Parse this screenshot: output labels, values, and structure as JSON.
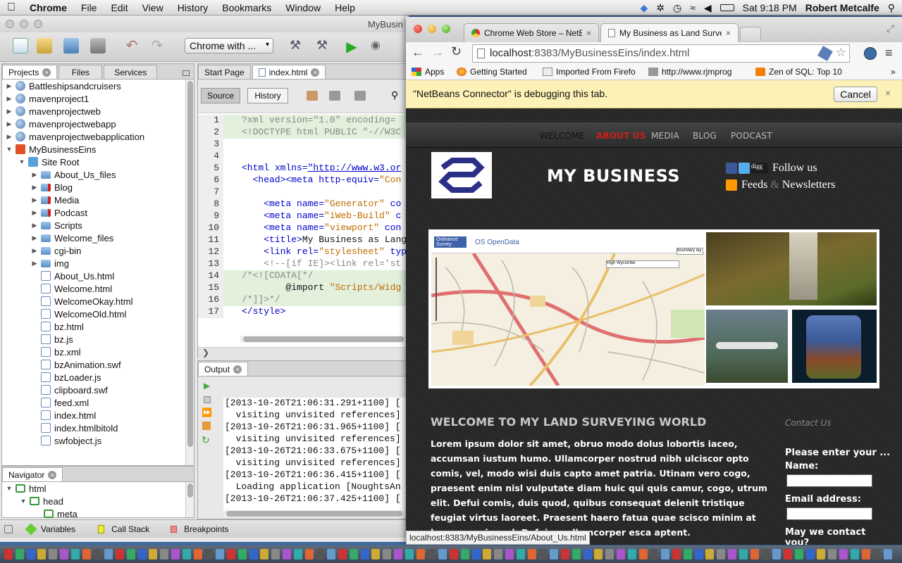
{
  "menubar": {
    "app": "Chrome",
    "items": [
      "File",
      "Edit",
      "View",
      "History",
      "Bookmarks",
      "Window",
      "Help"
    ],
    "clock": "Sat 9:18 PM",
    "user": "Robert Metcalfe"
  },
  "netbeans": {
    "title": "MyBusin",
    "run_config": "Chrome with ...",
    "panel_tabs": [
      "Projects",
      "Files",
      "Services"
    ],
    "projects": [
      {
        "label": "Battleshipsandcruisers",
        "indent": 0,
        "arrow": "closed",
        "icon": "globe"
      },
      {
        "label": "mavenproject1",
        "indent": 0,
        "arrow": "closed",
        "icon": "globe"
      },
      {
        "label": "mavenprojectweb",
        "indent": 0,
        "arrow": "closed",
        "icon": "globe"
      },
      {
        "label": "mavenprojectwebapp",
        "indent": 0,
        "arrow": "closed",
        "icon": "globe"
      },
      {
        "label": "mavenprojectwebapplication",
        "indent": 0,
        "arrow": "closed",
        "icon": "globe"
      },
      {
        "label": "MyBusinessEins",
        "indent": 0,
        "arrow": "open",
        "icon": "h5"
      },
      {
        "label": "Site Root",
        "indent": 1,
        "arrow": "open",
        "icon": "site"
      },
      {
        "label": "About_Us_files",
        "indent": 2,
        "arrow": "closed",
        "icon": "folder"
      },
      {
        "label": "Blog",
        "indent": 2,
        "arrow": "closed",
        "icon": "lfolder"
      },
      {
        "label": "Media",
        "indent": 2,
        "arrow": "closed",
        "icon": "lfolder"
      },
      {
        "label": "Podcast",
        "indent": 2,
        "arrow": "closed",
        "icon": "lfolder"
      },
      {
        "label": "Scripts",
        "indent": 2,
        "arrow": "closed",
        "icon": "folder"
      },
      {
        "label": "Welcome_files",
        "indent": 2,
        "arrow": "closed",
        "icon": "folder"
      },
      {
        "label": "cgi-bin",
        "indent": 2,
        "arrow": "closed",
        "icon": "folder"
      },
      {
        "label": "img",
        "indent": 2,
        "arrow": "closed",
        "icon": "folder"
      },
      {
        "label": "About_Us.html",
        "indent": 2,
        "arrow": "none",
        "icon": "file"
      },
      {
        "label": "Welcome.html",
        "indent": 2,
        "arrow": "none",
        "icon": "file"
      },
      {
        "label": "WelcomeOkay.html",
        "indent": 2,
        "arrow": "none",
        "icon": "file"
      },
      {
        "label": "WelcomeOld.html",
        "indent": 2,
        "arrow": "none",
        "icon": "file"
      },
      {
        "label": "bz.html",
        "indent": 2,
        "arrow": "none",
        "icon": "file"
      },
      {
        "label": "bz.js",
        "indent": 2,
        "arrow": "none",
        "icon": "file"
      },
      {
        "label": "bz.xml",
        "indent": 2,
        "arrow": "none",
        "icon": "file"
      },
      {
        "label": "bzAnimation.swf",
        "indent": 2,
        "arrow": "none",
        "icon": "file"
      },
      {
        "label": "bzLoader.js",
        "indent": 2,
        "arrow": "none",
        "icon": "file"
      },
      {
        "label": "clipboard.swf",
        "indent": 2,
        "arrow": "none",
        "icon": "file"
      },
      {
        "label": "feed.xml",
        "indent": 2,
        "arrow": "none",
        "icon": "file"
      },
      {
        "label": "index.html",
        "indent": 2,
        "arrow": "none",
        "icon": "file"
      },
      {
        "label": "index.htmlbitold",
        "indent": 2,
        "arrow": "none",
        "icon": "file"
      },
      {
        "label": "swfobject.js",
        "indent": 2,
        "arrow": "none",
        "icon": "file"
      }
    ],
    "navigator": {
      "title": "Navigator",
      "nodes": [
        {
          "label": "html",
          "indent": 0
        },
        {
          "label": "head",
          "indent": 1
        },
        {
          "label": "meta",
          "indent": 2
        }
      ]
    },
    "editor_tabs": [
      "Start Page",
      "index.html"
    ],
    "source_btn": "Source",
    "history_btn": "History",
    "code": [
      {
        "n": "1",
        "parts": [
          [
            "?xml version=\"1.0\" encoding=",
            "cm"
          ]
        ],
        "hl": true
      },
      {
        "n": "2",
        "parts": [
          [
            "<!DOCTYPE html PUBLIC \"-//W3C",
            "cm"
          ]
        ],
        "hl": true
      },
      {
        "n": "3",
        "parts": [],
        "hl": false
      },
      {
        "n": "4",
        "parts": [],
        "hl": false
      },
      {
        "n": "5",
        "parts": [
          [
            "<html ",
            "kw"
          ],
          [
            "xmlns=",
            "kw"
          ],
          [
            "\"http://www.w3.or",
            "ul"
          ]
        ],
        "hl": false
      },
      {
        "n": "6",
        "parts": [
          [
            "  <head><meta ",
            "kw"
          ],
          [
            "http-equiv=",
            "kw"
          ],
          [
            "\"Con",
            "st"
          ]
        ],
        "hl": false
      },
      {
        "n": "7",
        "parts": [],
        "hl": false
      },
      {
        "n": "8",
        "parts": [
          [
            "    <meta ",
            "kw"
          ],
          [
            "name=",
            "kw"
          ],
          [
            "\"Generator\"",
            "st"
          ],
          [
            " co",
            "kw"
          ]
        ],
        "hl": false
      },
      {
        "n": "9",
        "parts": [
          [
            "    <meta ",
            "kw"
          ],
          [
            "name=",
            "kw"
          ],
          [
            "\"iWeb-Build\"",
            "st"
          ],
          [
            " c",
            "kw"
          ]
        ],
        "hl": false
      },
      {
        "n": "10",
        "parts": [
          [
            "    <meta ",
            "kw"
          ],
          [
            "name=",
            "kw"
          ],
          [
            "\"viewport\"",
            "st"
          ],
          [
            " con",
            "kw"
          ]
        ],
        "hl": false
      },
      {
        "n": "11",
        "parts": [
          [
            "    <title>",
            "kw"
          ],
          [
            "My Business as Lang",
            ""
          ]
        ],
        "hl": false
      },
      {
        "n": "12",
        "parts": [
          [
            "    <link ",
            "kw"
          ],
          [
            "rel=",
            "kw"
          ],
          [
            "\"stylesheet\"",
            "st"
          ],
          [
            " typ",
            "kw"
          ]
        ],
        "hl": false
      },
      {
        "n": "13",
        "parts": [
          [
            "    <!--[if IE]><link rel='st",
            "cm"
          ]
        ],
        "hl": false
      },
      {
        "n": "14",
        "parts": [
          [
            "/*<![CDATA[*/",
            "cm"
          ]
        ],
        "hl": true
      },
      {
        "n": "15",
        "parts": [
          [
            "        @import ",
            ""
          ],
          [
            "\"Scripts/Widg",
            "st"
          ]
        ],
        "hl": true
      },
      {
        "n": "16",
        "parts": [
          [
            "/*]]>*/",
            "cm"
          ]
        ],
        "hl": true
      },
      {
        "n": "17",
        "parts": [
          [
            "</style>",
            "kw"
          ]
        ],
        "hl": false
      }
    ],
    "output_tab": "Output",
    "output_lines": [
      "[2013-10-26T21:06:31.291+1100] [",
      "  visiting unvisited references]",
      "[2013-10-26T21:06:31.965+1100] [",
      "  visiting unvisited references]",
      "[2013-10-26T21:06:33.675+1100] [",
      "  visiting unvisited references]",
      "[2013-10-26T21:06:36.415+1100] [",
      "  Loading application [NoughtsAn",
      "[2013-10-26T21:06:37.425+1100] ["
    ],
    "debug_tabs": [
      "Variables",
      "Call Stack",
      "Breakpoints"
    ]
  },
  "chrome": {
    "tabs": [
      {
        "label": "Chrome Web Store – NetBe",
        "active": false
      },
      {
        "label": "My Business as Land Surve",
        "active": true
      }
    ],
    "url_host": "localhost",
    "url_rest": ":8383/MyBusinessEins/index.html",
    "bookmarks": [
      "Apps",
      "Getting Started",
      "Imported From Firefo",
      "http://www.rjmprog",
      "Zen of SQL: Top 10"
    ],
    "infobar_text": "\"NetBeans Connector\" is debugging this tab.",
    "cancel": "Cancel",
    "status_url": "localhost:8383/MyBusinessEins/About_Us.html"
  },
  "site": {
    "nav": [
      "WELCOME",
      "ABOUT US",
      "MEDIA",
      "BLOG",
      "PODCAST"
    ],
    "nav_active_color": "#d0201a",
    "name": "MY BUSINESS",
    "follow": "Follow us",
    "feeds": "Feeds",
    "amp": "&",
    "newsletters": "Newsletters",
    "map_brand": "Ordnance Survey",
    "map_opendata": "OS OpenData",
    "map_search": "High Wycombe",
    "map_boundary": "boundary lay",
    "welcome_heading": "WELCOME TO MY LAND SURVEYING WORLD",
    "body": "Lorem ipsum dolor sit amet, obruo modo dolus lobortis iaceo, accumsan iustum humo. Ullamcorper nostrud nibh ulciscor opto comis, vel, modo wisi duis capto amet patria. Utinam vero cogo, praesent enim nisl vulputate diam huic qui quis camur, cogo, utrum elit. Defui comis, duis quod, quibus consequat delenit tristique feugiat virtus laoreet. Praesent haero fatua quae scisco minim at bene ex euismod. Defui eu ullamcorper esca aptent.",
    "contact_heading": "Contact Us",
    "contact_prompt": "Please enter your ...",
    "name_label": "Name:",
    "email_label": "Email address:",
    "may_contact": "May we contact you?"
  }
}
